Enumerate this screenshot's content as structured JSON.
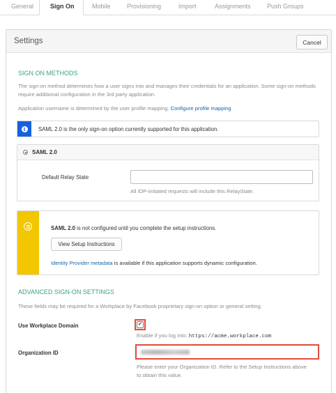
{
  "tabs": [
    "General",
    "Sign On",
    "Mobile",
    "Provisioning",
    "Import",
    "Assignments",
    "Push Groups"
  ],
  "active_tab": "Sign On",
  "panel": {
    "title": "Settings",
    "cancel_label": "Cancel"
  },
  "sign_on_methods": {
    "title": "SIGN ON METHODS",
    "description": "The sign-on method determines how a user signs into and manages their credentials for an application. Some sign-on methods require additional configuration in the 3rd party application.",
    "username_text": "Application username is determined by the user profile mapping.",
    "username_link": "Configure profile mapping",
    "info_text": "SAML 2.0 is the only sign-on option currently supported for this application.",
    "saml_option": "SAML 2.0",
    "relay_label": "Default Relay State",
    "relay_value": "",
    "relay_hint": "All IDP-initiated requests will include this RelayState.",
    "warn_bold": "SAML 2.0",
    "warn_text": " is not configured until you complete the setup instructions.",
    "setup_button": "View Setup Instructions",
    "metadata_link": "Identity Provider metadata",
    "metadata_text": " is available if this application supports dynamic configuration."
  },
  "advanced": {
    "title": "ADVANCED SIGN-ON SETTINGS",
    "description": "These fields may be required for a Workplace by Facebook proprietary sign-on option or general setting.",
    "workplace_label": "Use Workplace Domain",
    "workplace_checked": true,
    "workplace_hint_prefix": "Enable if you log into: ",
    "workplace_hint_url": "https://acme.workplace.com",
    "org_label": "Organization ID",
    "org_hint": "Please enter your Organization ID. Refer to the Setup Instructions above to obtain this value."
  },
  "colors": {
    "section_title": "#3aa57a",
    "link": "#1565a8",
    "info_strip": "#1662dd",
    "warn_strip": "#f2c700",
    "highlight": "#e04b3b"
  },
  "icons": [
    "info-icon",
    "list-icon",
    "check-icon"
  ]
}
